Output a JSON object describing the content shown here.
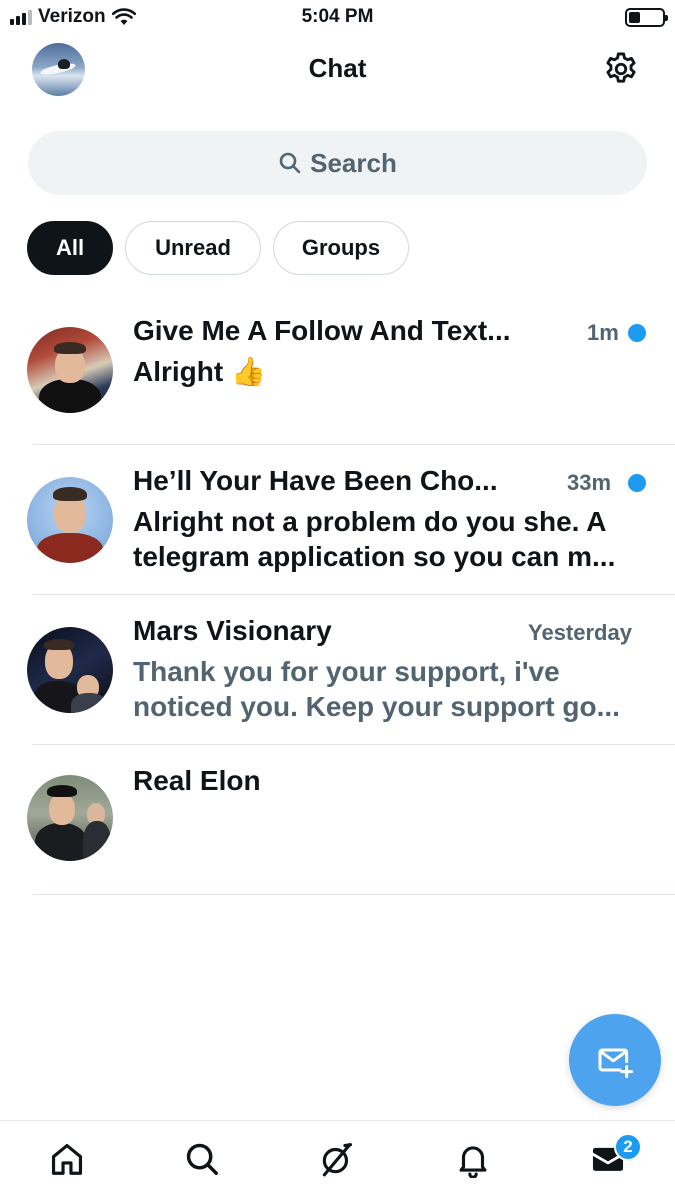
{
  "status_bar": {
    "carrier": "Verizon",
    "time": "5:04 PM"
  },
  "header": {
    "title": "Chat",
    "avatar_icon": "profile-avatar",
    "settings_icon": "gear-icon"
  },
  "search": {
    "label": "Search"
  },
  "filters": [
    {
      "label": "All",
      "active": true
    },
    {
      "label": "Unread",
      "active": false
    },
    {
      "label": "Groups",
      "active": false
    }
  ],
  "conversations": [
    {
      "name": "Give Me A Follow And Text...",
      "time": "1m",
      "unread": true,
      "preview": "Alright 👍"
    },
    {
      "name": "He’ll Your Have Been Cho...",
      "time": "33m",
      "unread": true,
      "preview": "Alright not a problem do you she. A telegram application so you can m..."
    },
    {
      "name": "Mars Visionary",
      "time": "Yesterday",
      "unread": false,
      "preview": "Thank you for your support, i've noticed you. Keep your support go..."
    },
    {
      "name": "Real Elon",
      "time": "",
      "unread": false,
      "preview": ""
    }
  ],
  "fab": {
    "icon": "new-message-icon"
  },
  "bottom_nav": {
    "items": [
      "home-icon",
      "search-icon",
      "grok-icon",
      "bell-icon",
      "mail-icon"
    ],
    "mail_badge": "2"
  },
  "colors": {
    "accent": "#1d9bf0",
    "fab": "#4da3ee",
    "text": "#0f1419",
    "secondary": "#536471",
    "search_bg": "#eff3f4"
  }
}
